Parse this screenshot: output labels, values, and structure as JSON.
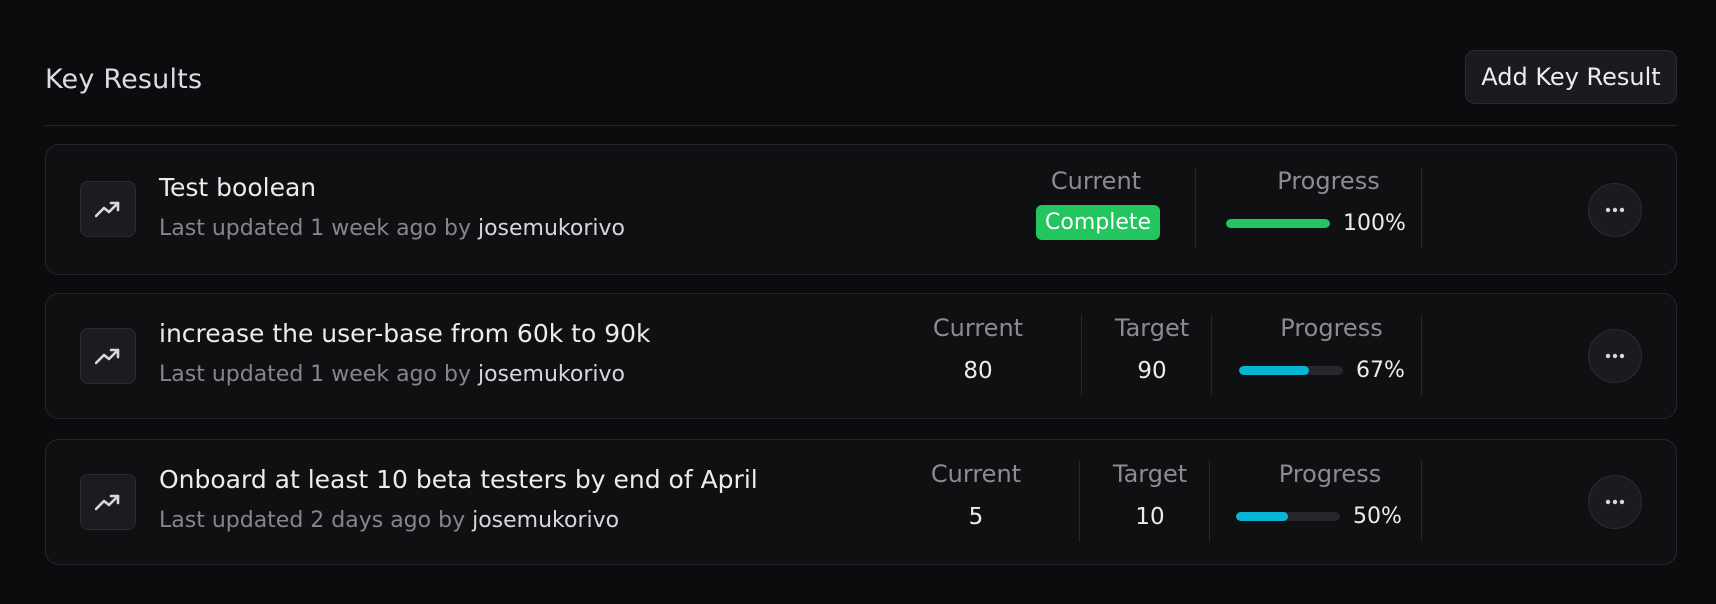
{
  "header": {
    "title": "Key Results",
    "add_button": "Add Key Result"
  },
  "colors": {
    "complete": "#22c55e",
    "progress_cyan": "#06b6d4",
    "track": "#25272c"
  },
  "key_results": [
    {
      "title": "Test boolean",
      "meta_prefix": "Last updated 1 week ago by",
      "author": "josemukorivo",
      "current_label": "Current",
      "current_value": "Complete",
      "progress_label": "Progress",
      "progress_text": "100%",
      "progress": 100
    },
    {
      "title": "increase the user-base from 60k to 90k",
      "meta_prefix": "Last updated 1 week ago by",
      "author": "josemukorivo",
      "current_label": "Current",
      "current_value": "80",
      "target_label": "Target",
      "target_value": "90",
      "progress_label": "Progress",
      "progress_text": "67%",
      "progress": 67
    },
    {
      "title": "Onboard at least 10 beta testers by end of April",
      "meta_prefix": "Last updated 2 days ago by",
      "author": "josemukorivo",
      "current_label": "Current",
      "current_value": "5",
      "target_label": "Target",
      "target_value": "10",
      "progress_label": "Progress",
      "progress_text": "50%",
      "progress": 50
    }
  ],
  "icons": {
    "key_result": "trending-up-icon",
    "more": "more-horizontal-icon"
  }
}
